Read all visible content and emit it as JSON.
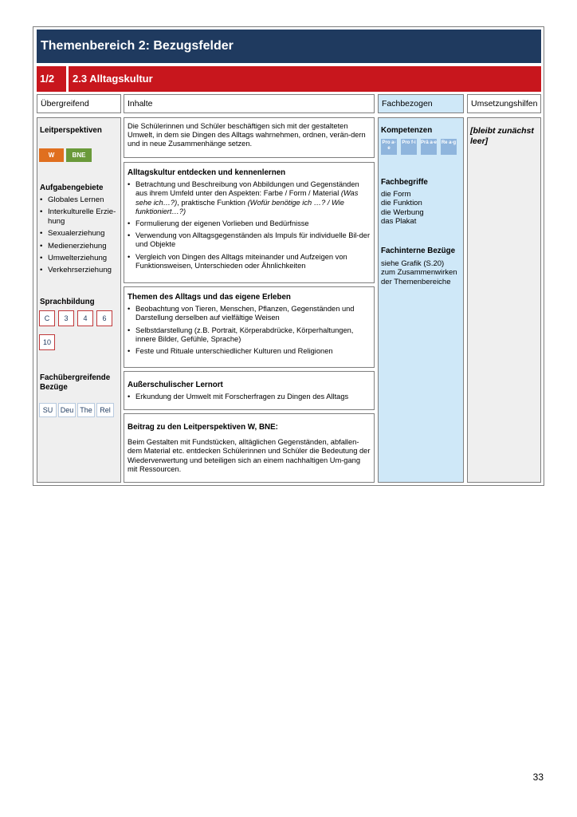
{
  "title": "Themenbereich 2: Bezugsfelder",
  "sub_number": "1/2",
  "sub_title": "2.3 Alltagskultur",
  "headers": {
    "uebergreifend": "Übergreifend",
    "inhalte": "Inhalte",
    "fachbezogen": "Fachbezogen",
    "umsetzungshilfen": "Umsetzungshilfen"
  },
  "left": {
    "leitperspektiven_label": "Leitperspektiven",
    "leitperspektiven": [
      {
        "label": "W",
        "color": "#e06f1f"
      },
      {
        "label": "BNE",
        "color": "#6a9a3a"
      }
    ],
    "aufgabengebiete_label": "Aufgabengebiete",
    "aufgabengebiete": [
      "Globales Lernen",
      "Interkulturelle Erzie-hung",
      "Sexualerziehung",
      "Medienerziehung",
      "Umwelterziehung",
      "Verkehrserziehung"
    ],
    "sprachbildung_label": "Sprachbildung",
    "sprachbildung": [
      "C",
      "3",
      "4",
      "6",
      "10"
    ],
    "fachuebergreifend_label_1": "Fachübergreifende",
    "fachuebergreifend_label_2": "Bezüge",
    "fachuebergreifend": [
      "SU",
      "Deu",
      "The",
      "Rel"
    ]
  },
  "inhalte": {
    "intro": "Die Schülerinnen und Schüler beschäftigen sich mit der gestalteten Umwelt, in dem sie Dingen des Alltags wahrnehmen, ordnen, verän-dern und in neue Zusammenhänge setzen.",
    "section1": {
      "heading": "Alltagskultur entdecken und kennenlernen",
      "item1_text": "Betrachtung und Beschreibung von Abbildungen und Gegenständen aus ihrem Umfeld unter den Aspekten: Farbe / Form / Material ",
      "item1_italic1": "(Was sehe ich…?)",
      "item1_mid": ", praktische Funktion ",
      "item1_italic2": "(Wofür benötige ich …? / Wie funktioniert…?)",
      "items": [
        "Formulierung der eigenen Vorlieben und Bedürfnisse",
        "Verwendung von Alltagsgegenständen als Impuls für individuelle Bil-der und Objekte",
        "Vergleich von Dingen des Alltags miteinander und Aufzeigen von Funktionsweisen, Unterschieden oder Ähnlichkeiten"
      ]
    },
    "section2": {
      "heading": "Themen des Alltags und das eigene Erleben",
      "items": [
        "Beobachtung von Tieren, Menschen, Pflanzen, Gegenständen und Darstellung derselben auf vielfältige Weisen",
        "Selbstdarstellung (z.B. Portrait, Körperabdrücke, Körperhaltungen, innere Bilder, Gefühle, Sprache)",
        "Feste und Rituale unterschiedlicher Kulturen und Religionen"
      ]
    },
    "section3": {
      "heading": "Außerschulischer Lernort",
      "items": [
        "Erkundung der Umwelt mit Forscherfragen zu Dingen des Alltags"
      ]
    },
    "section4": {
      "heading": "Beitrag zu den Leitperspektiven W, BNE:",
      "text": "Beim Gestalten mit Fundstücken, alltäglichen Gegenständen, abfallen-dem Material etc. entdecken Schülerinnen und Schüler die Bedeutung der Wiederverwertung und beteiligen sich an einem nachhaltigen Um-gang mit Ressourcen."
    }
  },
  "fach": {
    "kompetenzen_label": "Kompetenzen",
    "kompetenzen": [
      "Pro a-e",
      "Pro f-i",
      "Prä a-e",
      "Re a-g"
    ],
    "fachbegriffe_label": "Fachbegriffe",
    "fachbegriffe": [
      "die Form",
      "die Funktion",
      "die Werbung",
      "das Plakat"
    ],
    "fachinterne_label": "Fachinterne Bezüge",
    "fachinterne": [
      "siehe Grafik (S.20)",
      "zum Zusammenwirken",
      "der Themenbereiche"
    ]
  },
  "umsetzungshilfen": "[bleibt zunächst leer]",
  "page_number": "33"
}
